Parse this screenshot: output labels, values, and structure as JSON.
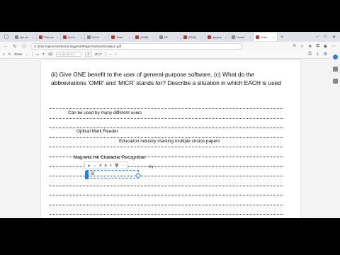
{
  "browser": {
    "tabs": [
      {
        "label": "wjc da"
      },
      {
        "label": "This wo"
      },
      {
        "label": "Kn*m"
      },
      {
        "label": "Kn*m"
      },
      {
        "label": "\"Infor"
      },
      {
        "label": "(ODB)"
      },
      {
        "label": "EF"
      },
      {
        "label": "(PDB)"
      },
      {
        "label": "applica"
      },
      {
        "label": "Learni"
      },
      {
        "label": "\"Infor",
        "active": true
      }
    ],
    "new_tab": "+",
    "window_controls": [
      "–",
      "□",
      "✕"
    ],
    "url": "C:/Information%20Technology%20Paper%20%20Solution.pdf"
  },
  "pdf_toolbar": {
    "draw_label": "Draw",
    "search_placeholder": "Find (Ctrl+F)",
    "page_number": "4",
    "page_total": "of 17",
    "zoom_out": "–",
    "zoom_in": "+"
  },
  "document": {
    "question": "(ii) Give ONE benefit to the user of general-purpose software. (c) What do the abbreviations 'OMR' and 'MICR' stands for? Describe a situation in which EACH is used",
    "answers": {
      "a1": "Can be used by many different users",
      "a2": "Optical Mark Reader",
      "a3": "Education industry marking multiple choice papers",
      "a4": "Magnetic Ink Character Recognition",
      "a5": "try",
      "typed": "B"
    }
  },
  "colors": {
    "accent": "#2b7de9"
  }
}
